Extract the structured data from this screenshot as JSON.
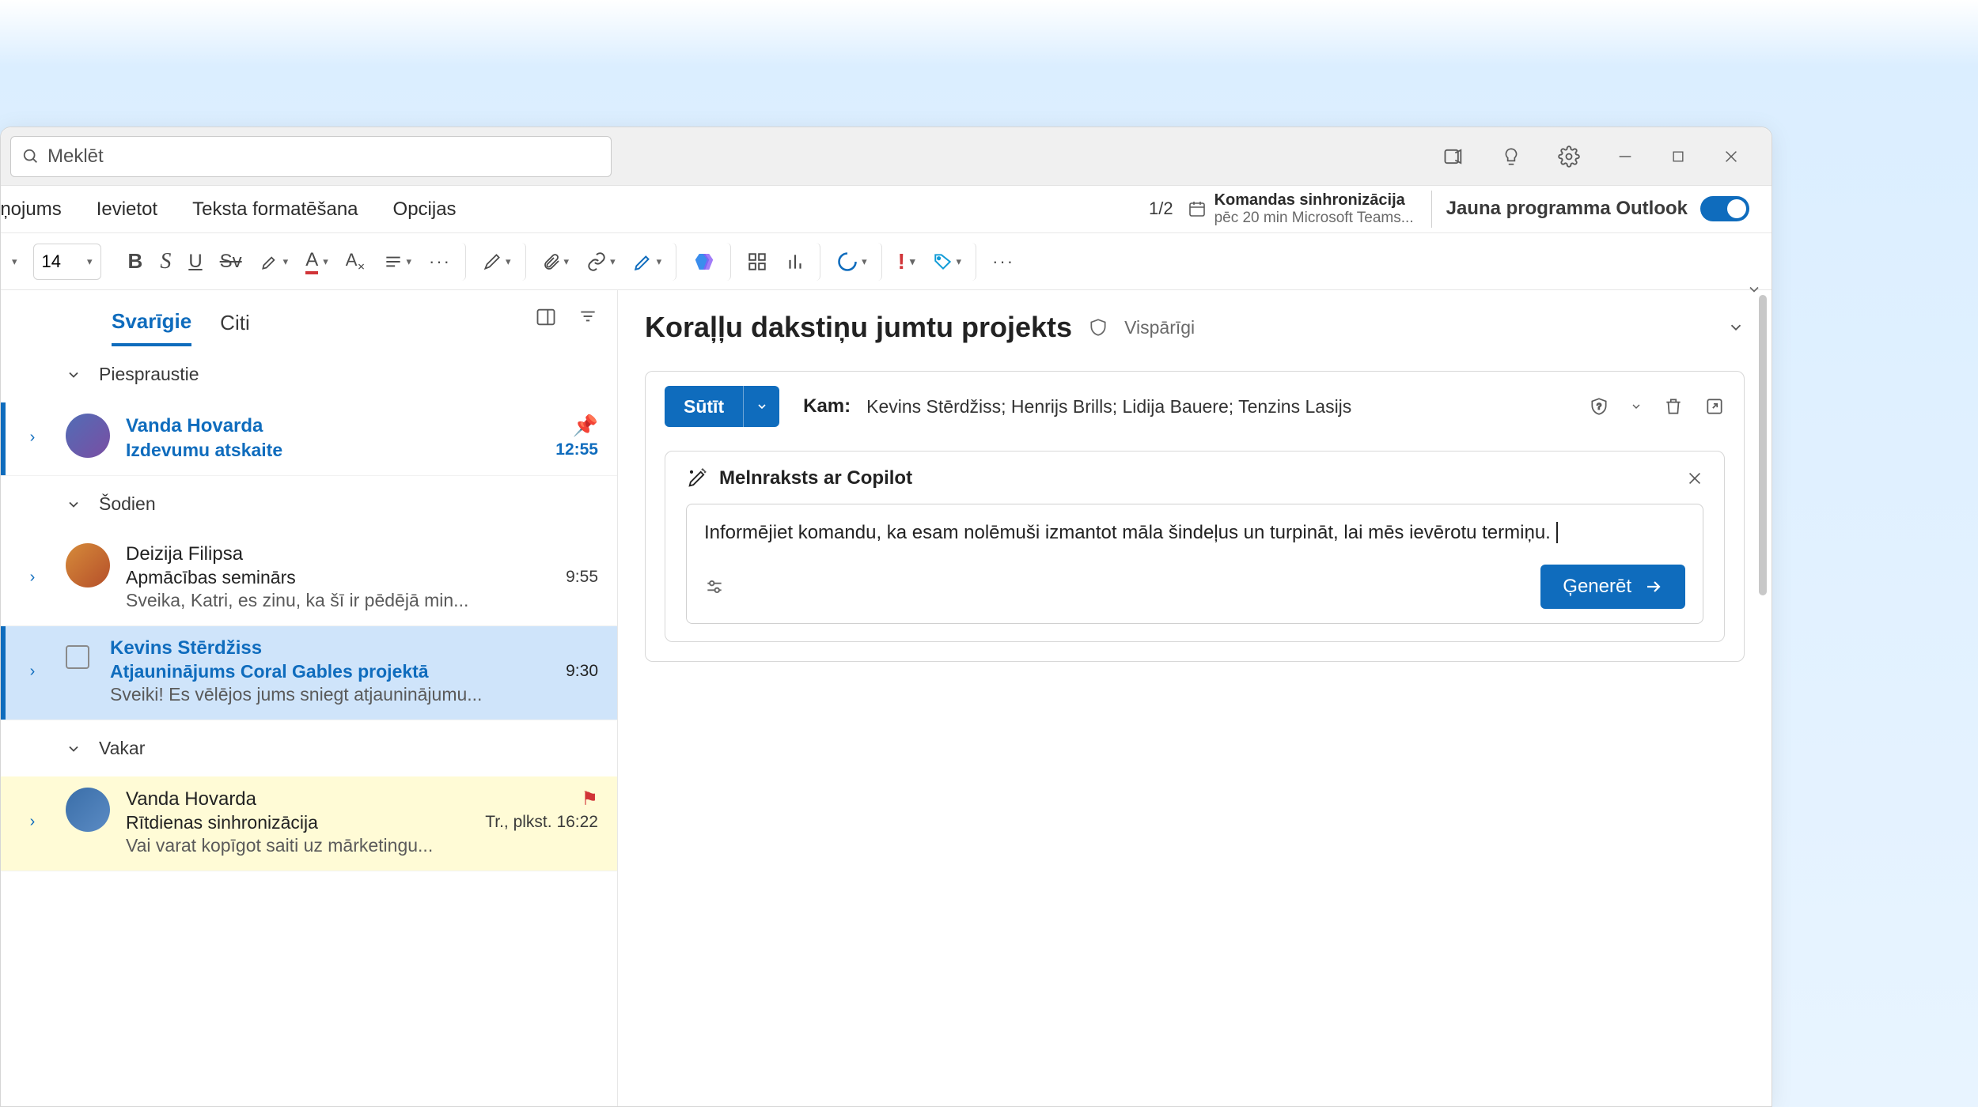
{
  "titlebar": {
    "search_placeholder": "Meklēt"
  },
  "ribbon_tabs": {
    "t0": "iņojums",
    "t1": "Ievietot",
    "t2": "Teksta formatēšana",
    "t3": "Opcijas"
  },
  "ribbon_right": {
    "counter": "1/2",
    "cal_title": "Komandas sinhronizācija",
    "cal_sub": "pēc 20 min Microsoft Teams...",
    "new_outlook": "Jauna programma Outlook"
  },
  "toolbar": {
    "fontsize": "14"
  },
  "list": {
    "tab_focused": "Svarīgie",
    "tab_other": "Citi",
    "section_pinned": "Piespraustie",
    "section_today": "Šodien",
    "section_yesterday": "Vakar",
    "m0": {
      "name": "Vanda Hovarda",
      "subj": "Izdevumu atskaite",
      "time": "12:55"
    },
    "m1": {
      "name": "Deizija Filipsa",
      "subj": "Apmācības seminārs",
      "time": "9:55",
      "prev": "Sveika, Katri, es zinu, ka šī ir pēdējā min..."
    },
    "m2": {
      "name": "Kevins Stērdžiss",
      "subj": "Atjauninājums Coral Gables projektā",
      "time": "9:30",
      "prev": "Sveiki! Es vēlējos jums sniegt atjauninājumu..."
    },
    "m3": {
      "name": "Vanda Hovarda",
      "subj": "Rītdienas sinhronizācija",
      "time": "Tr., plkst. 16:22",
      "prev": "Vai varat kopīgot saiti uz mārketingu..."
    }
  },
  "compose": {
    "subject": "Koraļļu dakstiņu jumtu projekts",
    "visparigi": "Vispārīgi",
    "send": "Sūtīt",
    "to_label": "Kam:",
    "to_names": "Kevins Stērdžiss; Henrijs Brills; Lidija Bauere; Tenzins Lasijs",
    "copilot_title": "Melnraksts ar Copilot",
    "copilot_prompt": "Informējiet komandu, ka esam nolēmuši izmantot māla šindeļus un turpināt, lai mēs ievērotu termiņu.",
    "generate": "Ģenerēt"
  }
}
